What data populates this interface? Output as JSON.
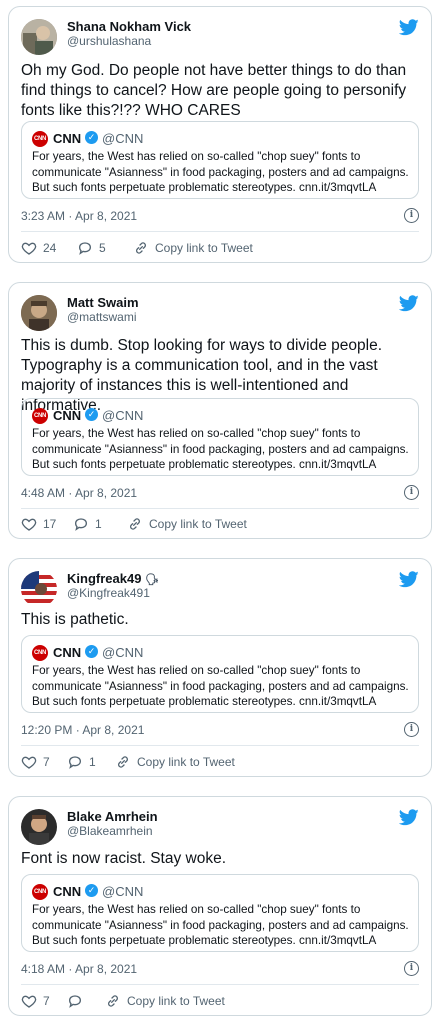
{
  "quoted": {
    "name": "CNN",
    "handle": "@CNN",
    "logo_text": "CNN",
    "text": "For years, the West has relied on so-called \"chop suey\" fonts to communicate \"Asianness\" in food packaging, posters and ad campaigns. But such fonts perpetuate problematic stereotypes. cnn.it/3mqvtLA"
  },
  "copy_label": "Copy link to Tweet",
  "tweets": [
    {
      "name": "Shana Nokham Vick",
      "handle": "@urshulashana",
      "text": "Oh my God.  Do people not have better things to do than find things to cancel? How are people going to personify fonts like this?!?? WHO CARES",
      "time": "3:23 AM · Apr 8, 2021",
      "likes": "24",
      "replies": "5"
    },
    {
      "name": "Matt Swaim",
      "handle": "@mattswami",
      "text": "This is dumb. Stop looking for ways to divide people. Typography is a communication tool, and in the vast majority of instances this is well-intentioned and informative.",
      "time": "4:48 AM · Apr 8, 2021",
      "likes": "17",
      "replies": "1"
    },
    {
      "name": "Kingfreak49",
      "handle": "@Kingfreak491",
      "text": "This is pathetic.",
      "time": "12:20 PM · Apr 8, 2021",
      "likes": "7",
      "replies": "1"
    },
    {
      "name": "Blake Amrhein",
      "handle": "@Blakeamrhein",
      "text": "Font is now racist. Stay woke.",
      "time": "4:18 AM · Apr 8, 2021",
      "likes": "7",
      "replies": ""
    }
  ],
  "icons": {
    "bird": "twitter-bird-icon",
    "like": "heart-icon",
    "reply": "reply-bubble-icon",
    "copy": "link-icon",
    "info": "info-icon",
    "verified": "verified-badge-icon",
    "voice": "speaking-head-icon"
  },
  "colors": {
    "twitter_blue": "#1d9bf0",
    "cnn_red": "#cc0000",
    "secondary_text": "#536471",
    "border": "#cfd9de"
  }
}
